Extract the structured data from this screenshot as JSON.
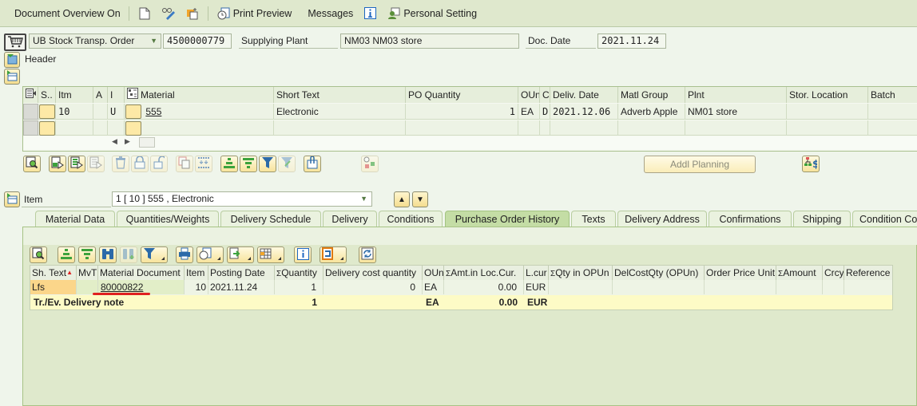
{
  "toolbar": {
    "document_overview": "Document Overview On",
    "new_icon": "new-document-icon",
    "display_change_icon": "display-change-icon",
    "other_document_icon": "other-document-icon",
    "print_preview": "Print Preview",
    "messages": "Messages",
    "info_icon": "info-icon",
    "personal_setting": "Personal Setting"
  },
  "header": {
    "doc_type": "UB Stock Transp. Order",
    "po_number": "4500000779",
    "supplying_plant_label": "Supplying Plant",
    "supplying_plant_value": "NM03 NM03 store",
    "doc_date_label": "Doc. Date",
    "doc_date_value": "2021.11.24",
    "header_label": "Header"
  },
  "item_grid": {
    "columns": [
      "S..",
      "Itm",
      "A",
      "I",
      "Material",
      "Short Text",
      "PO Quantity",
      "OUn",
      "C",
      "Deliv. Date",
      "Matl Group",
      "Plnt",
      "Stor. Location",
      "Batch"
    ],
    "rows": [
      {
        "itm": "10",
        "a": "",
        "i": "U",
        "material": "555",
        "short_text": "Electronic",
        "po_quantity": "1",
        "oun": "EA",
        "c": "D",
        "deliv_date": "2021.12.06",
        "matl_group": "Adverb Apple",
        "plnt": "NM01 store",
        "stor_location": "",
        "batch": ""
      },
      {
        "itm": "",
        "a": "",
        "i": "",
        "material": "",
        "short_text": "",
        "po_quantity": "",
        "oun": "",
        "c": "",
        "deliv_date": "",
        "matl_group": "",
        "plnt": "",
        "stor_location": "",
        "batch": ""
      }
    ]
  },
  "item_actions": {
    "addl_planning": "Addl Planning"
  },
  "item_selector": {
    "label": "Item",
    "value": "1 [ 10 ] 555 , Electronic"
  },
  "tabs": [
    {
      "label": "Material Data",
      "active": false
    },
    {
      "label": "Quantities/Weights",
      "active": false
    },
    {
      "label": "Delivery Schedule",
      "active": false
    },
    {
      "label": "Delivery",
      "active": false
    },
    {
      "label": "Conditions",
      "active": false
    },
    {
      "label": "Purchase Order History",
      "active": true
    },
    {
      "label": "Texts",
      "active": false
    },
    {
      "label": "Delivery Address",
      "active": false
    },
    {
      "label": "Confirmations",
      "active": false
    },
    {
      "label": "Shipping",
      "active": false
    },
    {
      "label": "Condition Co",
      "active": false
    }
  ],
  "history": {
    "columns": [
      "Sh. Text",
      "MvT",
      "Material Document",
      "Item",
      "Posting Date",
      "Quantity",
      "Delivery cost quantity",
      "OUn",
      "Amt.in Loc.Cur.",
      "L.cur",
      "Qty in OPUn",
      "DelCostQty (OPUn)",
      "Order Price Unit",
      "Amount",
      "Crcy",
      "Reference"
    ],
    "sum_symbol": "Σ",
    "rows": [
      {
        "sh_text": "Lfs",
        "mvt": "",
        "material_document": "80000822",
        "item": "10",
        "posting_date": "2021.11.24",
        "quantity": "1",
        "delivery_cost_quantity": "0",
        "oun": "EA",
        "amt_loc_cur": "0.00",
        "l_cur": "EUR"
      }
    ],
    "total": {
      "label": "Tr./Ev. Delivery note",
      "quantity": "1",
      "oun": "EA",
      "amt_loc_cur": "0.00",
      "l_cur": "EUR"
    }
  },
  "colors": {
    "toolbar_bg": "#dfe8cd",
    "page_bg": "#eff5eb",
    "active_tab": "#c4dda5",
    "total_row": "#fdfbc6",
    "annotation_underline": "#e02020"
  }
}
